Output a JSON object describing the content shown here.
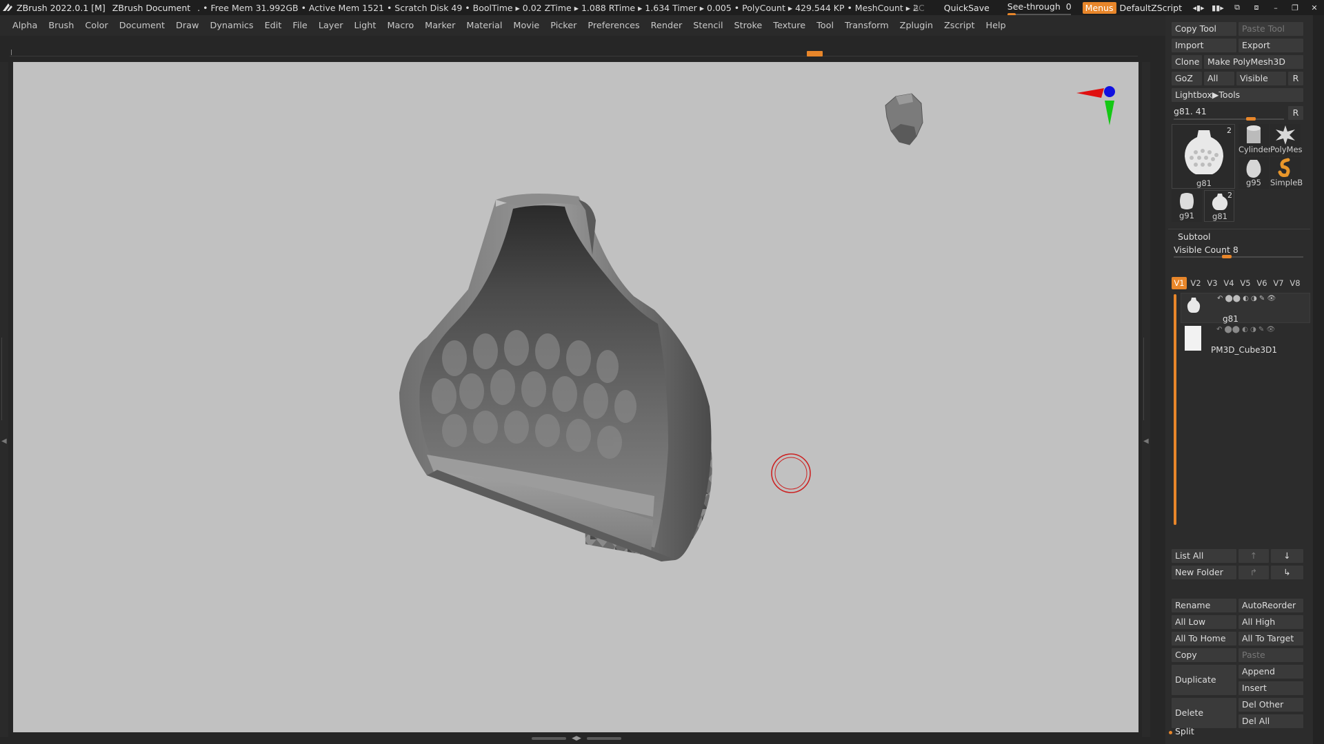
{
  "app": {
    "title": "ZBrush 2022.0.1 [M]",
    "document": "ZBrush Document",
    "stats": ". • Free Mem 31.992GB • Active Mem 1521 • Scratch Disk 49 •  BoolTime ▸ 0.02 ZTime ▸ 1.088 RTime ▸ 1.634 Timer ▸ 0.005 • PolyCount ▸ 429.544 KP • MeshCount ▸ 2"
  },
  "titlebar_right": {
    "ac": "AC",
    "quicksave": "QuickSave",
    "see_through_label": "See-through",
    "see_through_value": "0",
    "see_through_fraction": 0,
    "menus": "Menus",
    "script": "DefaultZScript"
  },
  "menus": [
    "Alpha",
    "Brush",
    "Color",
    "Document",
    "Draw",
    "Dynamics",
    "Edit",
    "File",
    "Layer",
    "Light",
    "Macro",
    "Marker",
    "Material",
    "Movie",
    "Picker",
    "Preferences",
    "Render",
    "Stencil",
    "Stroke",
    "Texture",
    "Tool",
    "Transform",
    "Zplugin",
    "Zscript",
    "Help"
  ],
  "colors": {
    "accent": "#e8862a",
    "viewport_bg": "#c1c1c1",
    "panel_bg": "#2c2c2c",
    "button_bg": "#3a3a3a",
    "gizmo_x": "#e01010",
    "gizmo_y": "#14c814",
    "gizmo_z": "#1010e0",
    "cursor": "#cc2222"
  },
  "tool_palette": {
    "copy_tool": "Copy Tool",
    "paste_tool": "Paste Tool",
    "import": "Import",
    "export": "Export",
    "clone": "Clone",
    "make_polymesh": "Make PolyMesh3D",
    "goz": "GoZ",
    "all": "All",
    "visible": "Visible",
    "r": "R",
    "lightbox_tools": "Lightbox▶Tools",
    "current_tool": "g81. 41",
    "current_tool_slider": 0.72,
    "main_thumb_label": "g81",
    "main_thumb_count": "2",
    "thumbs": [
      {
        "label": "Cylinder",
        "icon": "cylinder-icon"
      },
      {
        "label": "PolyMes",
        "icon": "star-icon"
      },
      {
        "label": "g95",
        "icon": "vase-icon"
      },
      {
        "label": "SimpleB",
        "icon": "simplebrush-icon"
      },
      {
        "label": "g91",
        "icon": "vase-icon"
      },
      {
        "label": "g81",
        "icon": "vase-icon",
        "count": "2"
      }
    ]
  },
  "subtool": {
    "header": "Subtool",
    "visible_count": "Visible Count 8",
    "visible_count_slider": 0.4,
    "views": [
      "V1",
      "V2",
      "V3",
      "V4",
      "V5",
      "V6",
      "V7",
      "V8"
    ],
    "active_view": "V1",
    "items": [
      {
        "name": "g81",
        "icon": "vase-icon"
      },
      {
        "name": "PM3D_Cube3D1",
        "icon": "cube-icon"
      }
    ],
    "list_all": "List All",
    "new_folder": "New Folder",
    "rename": "Rename",
    "autoreorder": "AutoReorder",
    "all_low": "All Low",
    "all_high": "All High",
    "all_to_home": "All To Home",
    "all_to_target": "All To Target",
    "copy": "Copy",
    "paste": "Paste",
    "duplicate": "Duplicate",
    "append": "Append",
    "insert": "Insert",
    "delete": "Delete",
    "del_other": "Del Other",
    "del_all": "Del All",
    "split": "Split"
  }
}
